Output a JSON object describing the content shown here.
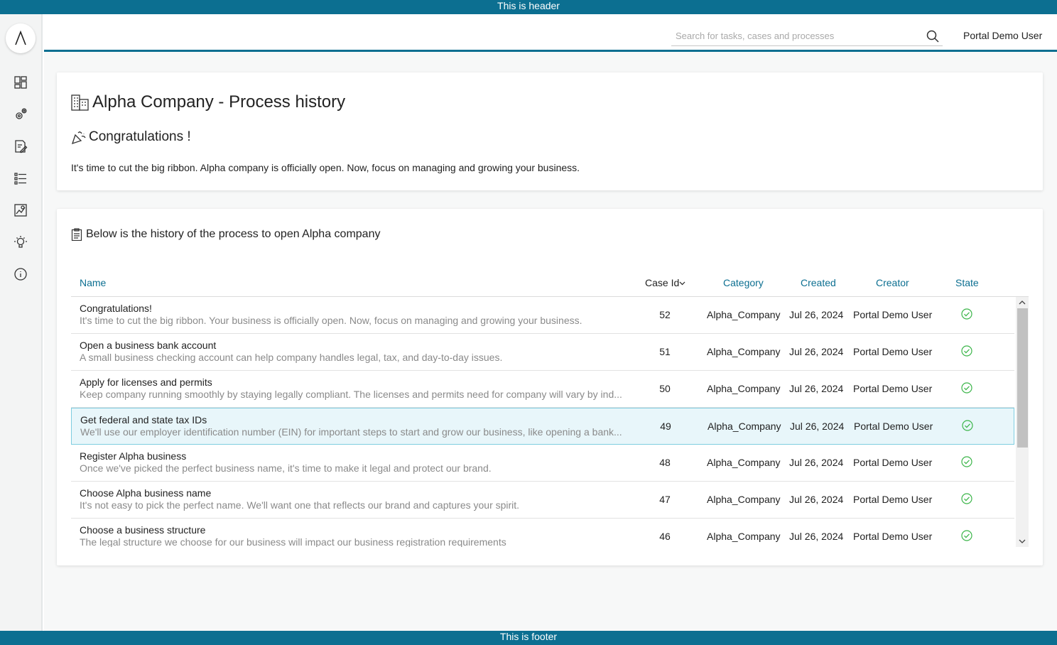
{
  "banner": {
    "header": "This is header",
    "footer": "This is footer"
  },
  "sidebar": {
    "logo": "Λ",
    "items": [
      {
        "icon": "dashboard-icon"
      },
      {
        "icon": "processes-icon"
      },
      {
        "icon": "tasks-icon"
      },
      {
        "icon": "cases-icon"
      },
      {
        "icon": "statistics-icon"
      },
      {
        "icon": "idea-icon"
      },
      {
        "icon": "info-icon"
      }
    ]
  },
  "topbar": {
    "search_placeholder": "Search for tasks, cases and processes",
    "user": "Portal Demo User"
  },
  "summary": {
    "title": "Alpha Company - Process history",
    "subtitle": "Congratulations !",
    "text": "It's time to cut the big ribbon. Alpha company is officially open. Now, focus on managing and growing your business."
  },
  "history": {
    "title": "Below is the history of the process to open Alpha company",
    "columns": {
      "name": "Name",
      "case_id": "Case Id",
      "category": "Category",
      "created": "Created",
      "creator": "Creator",
      "state": "State"
    },
    "rows": [
      {
        "name": "Congratulations!",
        "desc": "It's time to cut the big ribbon. Your business is officially open. Now, focus on managing and growing your business.",
        "id": "52",
        "category": "Alpha_Company",
        "created": "Jul 26, 2024",
        "creator": "Portal Demo User"
      },
      {
        "name": "Open a business bank account",
        "desc": "A small business checking account can help company handles legal, tax, and day-to-day issues.",
        "id": "51",
        "category": "Alpha_Company",
        "created": "Jul 26, 2024",
        "creator": "Portal Demo User"
      },
      {
        "name": "Apply for licenses and permits",
        "desc": "Keep company running smoothly by staying legally compliant. The licenses and permits need for company will vary by ind...",
        "id": "50",
        "category": "Alpha_Company",
        "created": "Jul 26, 2024",
        "creator": "Portal Demo User"
      },
      {
        "name": "Get federal and state tax IDs",
        "desc": "We'll use our employer identification number (EIN) for important steps to start and grow our business, like opening a bank...",
        "id": "49",
        "category": "Alpha_Company",
        "created": "Jul 26, 2024",
        "creator": "Portal Demo User"
      },
      {
        "name": "Register Alpha business",
        "desc": "Once we've picked the perfect business name, it's time to make it legal and protect our brand.",
        "id": "48",
        "category": "Alpha_Company",
        "created": "Jul 26, 2024",
        "creator": "Portal Demo User"
      },
      {
        "name": "Choose Alpha business name",
        "desc": "It's not easy to pick the perfect name. We'll want one that reflects our brand and captures your spirit.",
        "id": "47",
        "category": "Alpha_Company",
        "created": "Jul 26, 2024",
        "creator": "Portal Demo User"
      },
      {
        "name": "Choose a business structure",
        "desc": "The legal structure we choose for our business will impact our business registration requirements",
        "id": "46",
        "category": "Alpha_Company",
        "created": "Jul 26, 2024",
        "creator": "Portal Demo User"
      }
    ]
  },
  "colors": {
    "accent": "#0c6f91",
    "done": "#3cb54a",
    "selected_row": "#e8f6fa"
  }
}
